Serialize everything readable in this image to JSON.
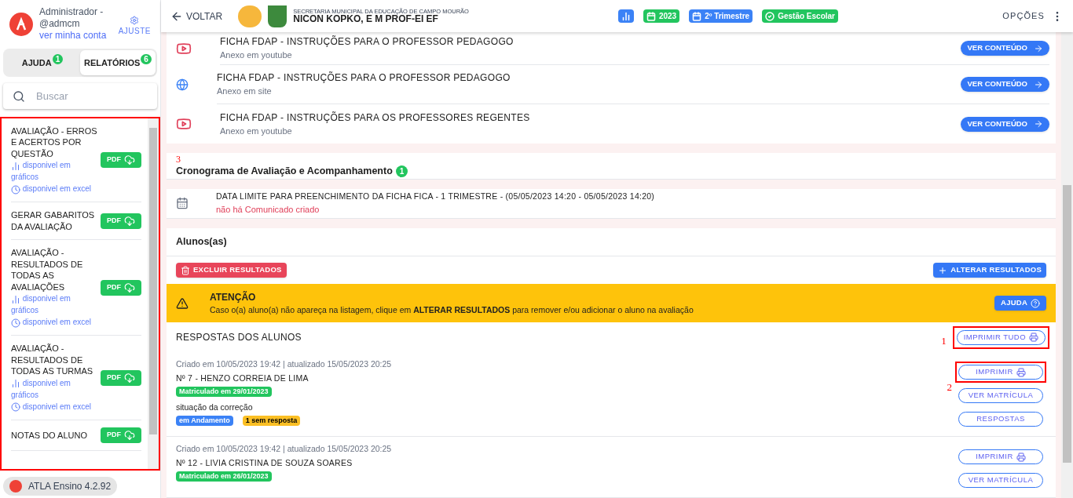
{
  "user": {
    "name": "Administrador - @admcm",
    "account_link": "ver minha conta",
    "settings_label": "AJUSTE"
  },
  "sidebar_tabs": [
    {
      "label": "AJUDA",
      "count": "1",
      "selected": false
    },
    {
      "label": "RELATÓRIOS",
      "count": "6",
      "selected": true
    }
  ],
  "search": {
    "placeholder": "Buscar"
  },
  "reports": {
    "highlighted": true,
    "items": [
      {
        "title": "AVALIAÇÃO - ERROS E ACERTOS POR QUESTÃO",
        "button": "PDF",
        "links": [
          {
            "kind": "charts",
            "label": "disponivel em gráficos"
          },
          {
            "kind": "excel",
            "label": "disponivel em excel"
          }
        ]
      },
      {
        "title": "GERAR GABARITOS DA AVALIAÇÃO",
        "button": "PDF"
      },
      {
        "title": "AVALIAÇÃO - RESULTADOS DE TODAS AS AVALIAÇÕES",
        "button": "PDF",
        "links": [
          {
            "kind": "charts",
            "label": "disponivel em gráficos"
          },
          {
            "kind": "excel",
            "label": "disponivel em excel"
          }
        ]
      },
      {
        "title": "AVALIAÇÃO - RESULTADOS DE TODAS AS TURMAS",
        "button": "PDF",
        "links": [
          {
            "kind": "charts",
            "label": "disponivel em gráficos"
          },
          {
            "kind": "excel",
            "label": "disponivel em excel"
          }
        ]
      },
      {
        "title": "NOTAS DO ALUNO",
        "button": "PDF"
      }
    ]
  },
  "version": "ATLA Ensino 4.2.92",
  "header": {
    "back": "VOLTAR",
    "org": "SECRETARIA MUNICIPAL DA EDUCAÇÃO DE CAMPO MOURÃO",
    "school": "NICON KOPKO, E M PROF-EI EF",
    "badges": [
      {
        "kind": "chart",
        "color": "#3b82f6"
      },
      {
        "kind": "calendar",
        "label": "2023",
        "color": "#22c55e"
      },
      {
        "kind": "calendar",
        "label": "2º Trimestre",
        "color": "#3b82f6"
      },
      {
        "kind": "check",
        "label": "Gestão Escolar",
        "color": "#22c55e"
      }
    ],
    "options": "OPÇÕES"
  },
  "attachments": [
    {
      "kind": "youtube",
      "title": "FICHA FDAP - INSTRUÇÕES PARA O PROFESSOR PEDAGOGO",
      "subtitle": "Anexo em youtube",
      "button": "VER CONTEÚDO"
    },
    {
      "kind": "site",
      "title": "FICHA FDAP - INSTRUÇÕES PARA O PROFESSOR PEDAGOGO",
      "subtitle": "Anexo em site",
      "button": "VER CONTEÚDO"
    },
    {
      "kind": "youtube",
      "title": "FICHA FDAP - INSTRUÇÕES PARA OS PROFESSORES REGENTES",
      "subtitle": "Anexo em youtube",
      "button": "VER CONTEÚDO"
    }
  ],
  "schedule": {
    "annotation": "3",
    "title": "Cronograma de Avaliação e Acompanhamento",
    "count": "1",
    "items": [
      {
        "title": "DATA LIMITE PARA PREENCHIMENTO DA FICHA FICA - 1 TRIMESTRE - (05/05/2023 14:20 - 05/05/2023 14:20)",
        "note": "não há Comunicado criado"
      }
    ]
  },
  "students_section": {
    "title": "Alunos(as)",
    "delete_button": "EXCLUIR RESULTADOS",
    "change_button": "ALTERAR RESULTADOS",
    "alert": {
      "title": "ATENÇÃO",
      "message": "Caso o(a) aluno(a) não apareça na listagem, clique em **ALTERAR RESULTADOS** para remover e/ou adicionar o aluno na avaliação",
      "button": "AJUDA"
    },
    "answers_title": "RESPOSTAS DOS ALUNOS",
    "print_all": {
      "label": "IMPRIMIR TUDO",
      "annotation": "1",
      "highlighted": true
    },
    "students": [
      {
        "meta": "Criado em 10/05/2023 19:42 | atualizado 15/05/2023 20:25",
        "name": "Nº 7 - HENZO CORREIA DE LIMA",
        "enrolled": "Matriculado em 29/01/2023",
        "status_label": "situação da correção",
        "tags": [
          {
            "label": "em Andamento",
            "color": "#3b82f6"
          },
          {
            "label": "1 sem resposta",
            "color": "#fbbf24"
          }
        ],
        "buttons": [
          {
            "label": "IMPRIMIR",
            "kind": "print",
            "highlighted": true,
            "annotation": "2"
          },
          {
            "label": "VER MATRÍCULA",
            "kind": "plain",
            "highlighted": false
          },
          {
            "label": "RESPOSTAS",
            "kind": "plain",
            "highlighted": false
          }
        ]
      },
      {
        "meta": "Criado em 10/05/2023 19:42 | atualizado 15/05/2023 20:25",
        "name": "Nº 12 - LIVIA CRISTINA DE SOUZA SOARES",
        "enrolled": "Matriculado em 26/01/2023",
        "buttons": [
          {
            "label": "IMPRIMIR",
            "kind": "print",
            "highlighted": false
          },
          {
            "label": "VER MATRÍCULA",
            "kind": "plain",
            "highlighted": false
          }
        ]
      }
    ]
  }
}
